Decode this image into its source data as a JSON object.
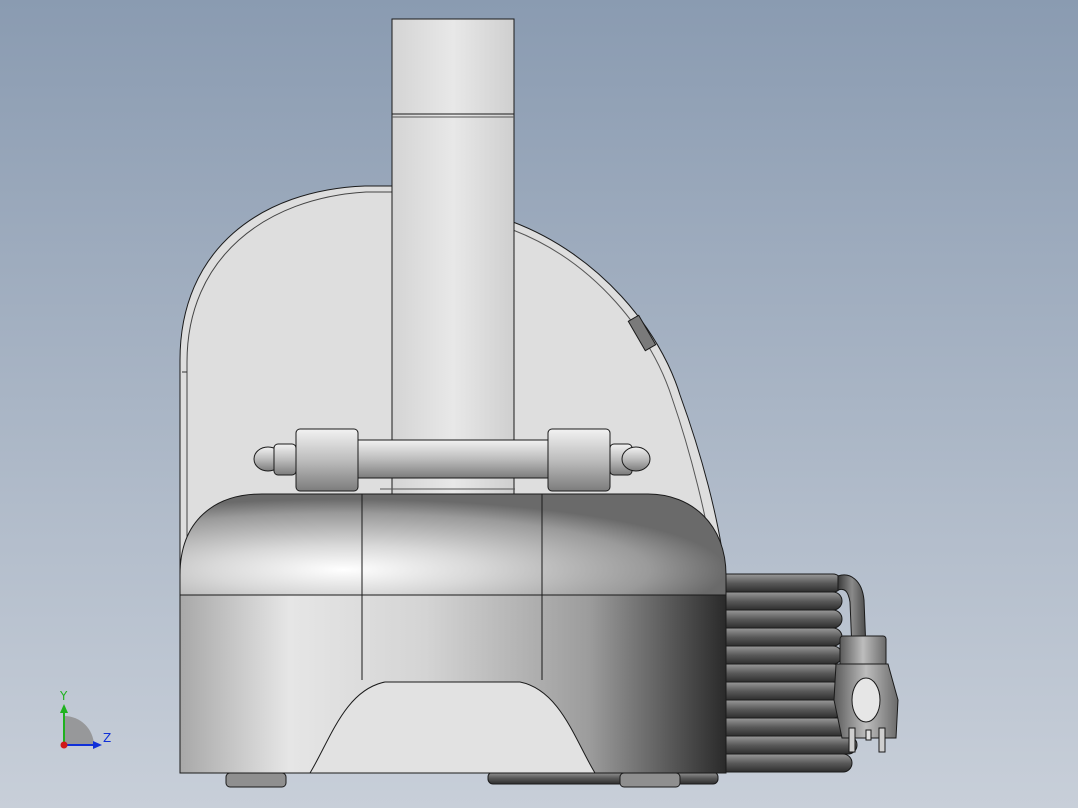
{
  "viewport": {
    "background_top": "#8a9bb1",
    "background_bottom": "#c8cfd9"
  },
  "triad": {
    "y_label": "Y",
    "z_label": "Z",
    "y_color": "#1fb21f",
    "z_color": "#1030d8",
    "x_color": "#d01818"
  },
  "model": {
    "line_color": "#1a1a1a",
    "body_fill": "#dcdcdc",
    "cord_fill": "#6e6e6e"
  }
}
